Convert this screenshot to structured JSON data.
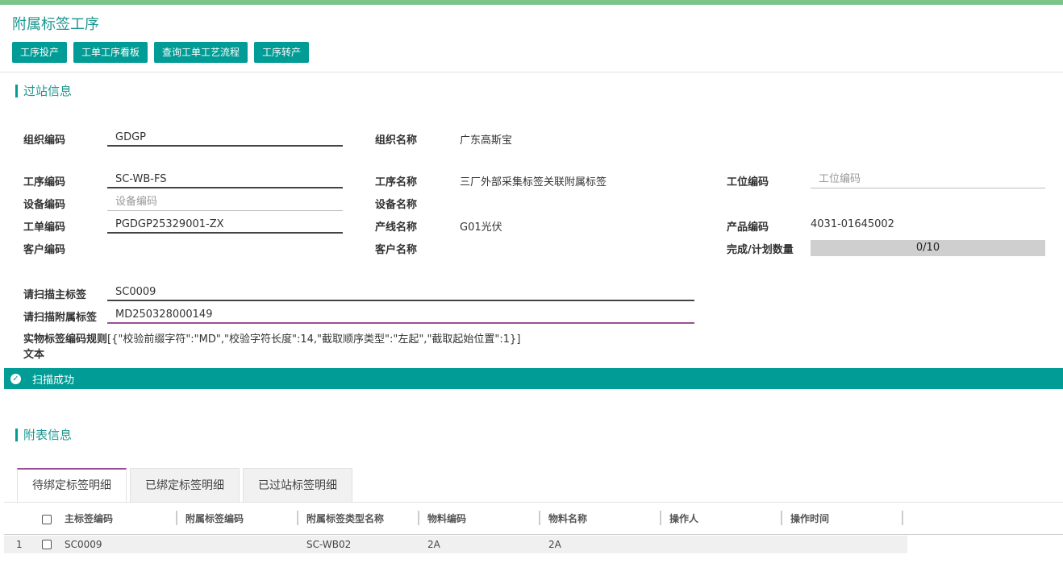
{
  "page": {
    "title": "附属标签工序"
  },
  "toolbar": {
    "buttons": [
      "工序投产",
      "工单工序看板",
      "查询工单工艺流程",
      "工序转产"
    ]
  },
  "sections": {
    "pass_station": "过站信息",
    "attached": "附表信息"
  },
  "form": {
    "org_code_label": "组织编码",
    "org_code_value": "GDGP",
    "org_name_label": "组织名称",
    "org_name_value": "广东高斯宝",
    "process_code_label": "工序编码",
    "process_code_value": "SC-WB-FS",
    "process_name_label": "工序名称",
    "process_name_value": "三厂外部采集标签关联附属标签",
    "station_code_label": "工位编码",
    "station_code_placeholder": "工位编码",
    "device_code_label": "设备编码",
    "device_code_placeholder": "设备编码",
    "device_name_label": "设备名称",
    "work_order_label": "工单编码",
    "work_order_value": "PGDGP25329001-ZX",
    "line_name_label": "产线名称",
    "line_name_value": "G01光伏",
    "product_code_label": "产品编码",
    "product_code_value": "4031-01645002",
    "customer_code_label": "客户编码",
    "customer_name_label": "客户名称",
    "qty_label": "完成/计划数量",
    "qty_value": "0/10",
    "qty_progress": 0,
    "scan_main_label": "请扫描主标签",
    "scan_main_value": "SC0009",
    "scan_attached_label": "请扫描附属标签",
    "scan_attached_value": "MD250328000149",
    "rule_label_line1": "实物标签编码规则",
    "rule_label_line2": "文本",
    "rule_text": "[{\"校验前缀字符\":\"MD\",\"校验字符长度\":14,\"截取顺序类型\":\"左起\",\"截取起始位置\":1}]"
  },
  "status": {
    "icon": "check-icon",
    "message": "扫描成功"
  },
  "tabs": [
    {
      "label": "待绑定标签明细",
      "active": true
    },
    {
      "label": "已绑定标签明细",
      "active": false
    },
    {
      "label": "已过站标签明细",
      "active": false
    }
  ],
  "table": {
    "columns": [
      "主标签编码",
      "附属标签编码",
      "附属标签类型名称",
      "物料编码",
      "物料名称",
      "操作人",
      "操作时间"
    ],
    "rows": [
      {
        "index": "1",
        "main": "SC0009",
        "attached": "",
        "type": "SC-WB02",
        "material_code": "2A",
        "material_name": "2A",
        "operator": "",
        "time": ""
      }
    ]
  },
  "colors": {
    "accent": "#009c95",
    "title": "#1b9690",
    "focus": "#9b4f96",
    "top_bar": "#7cc48a"
  }
}
